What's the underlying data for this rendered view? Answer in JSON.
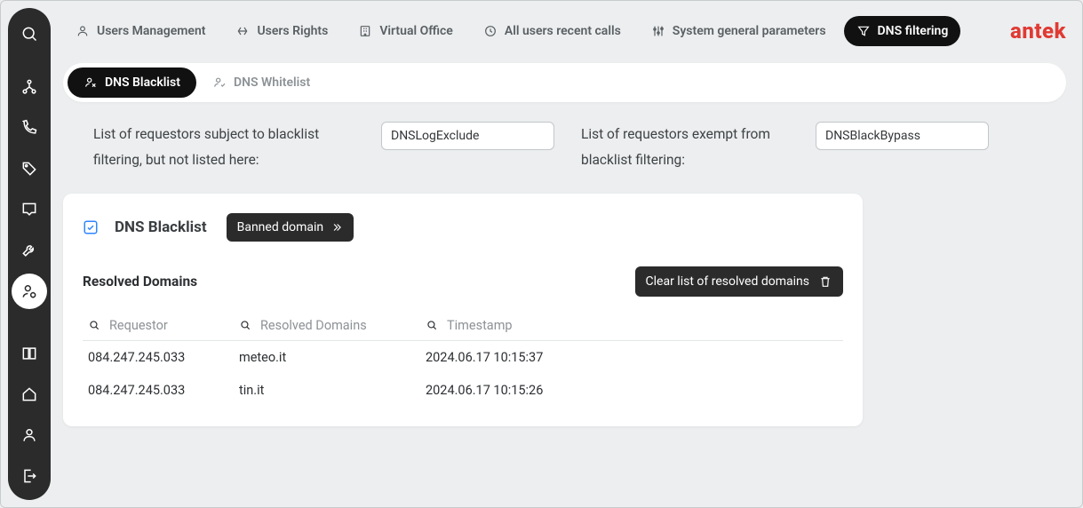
{
  "brand": "antek",
  "topnav": {
    "users_management": "Users Management",
    "users_rights": "Users Rights",
    "virtual_office": "Virtual Office",
    "recent_calls": "All users recent calls",
    "system_params": "System general parameters",
    "dns_filtering": "DNS filtering"
  },
  "tabs": {
    "blacklist": "DNS Blacklist",
    "whitelist": "DNS Whitelist"
  },
  "filters": {
    "blacklist_label": "List of requestors subject to blacklist filtering, but not listed here:",
    "blacklist_value": "DNSLogExclude",
    "exempt_label": "List of requestors exempt from blacklist filtering:",
    "exempt_value": "DNSBlackBypass"
  },
  "panel": {
    "title": "DNS Blacklist",
    "banned_btn": "Banned domain",
    "resolved_title": "Resolved Domains",
    "clear_btn": "Clear list of resolved domains",
    "columns": {
      "requestor": "Requestor",
      "domains": "Resolved Domains",
      "timestamp": "Timestamp"
    },
    "rows": [
      {
        "requestor": "084.247.245.033",
        "domain": "meteo.it",
        "timestamp": "2024.06.17 10:15:37"
      },
      {
        "requestor": "084.247.245.033",
        "domain": "tin.it",
        "timestamp": "2024.06.17 10:15:26"
      }
    ]
  }
}
